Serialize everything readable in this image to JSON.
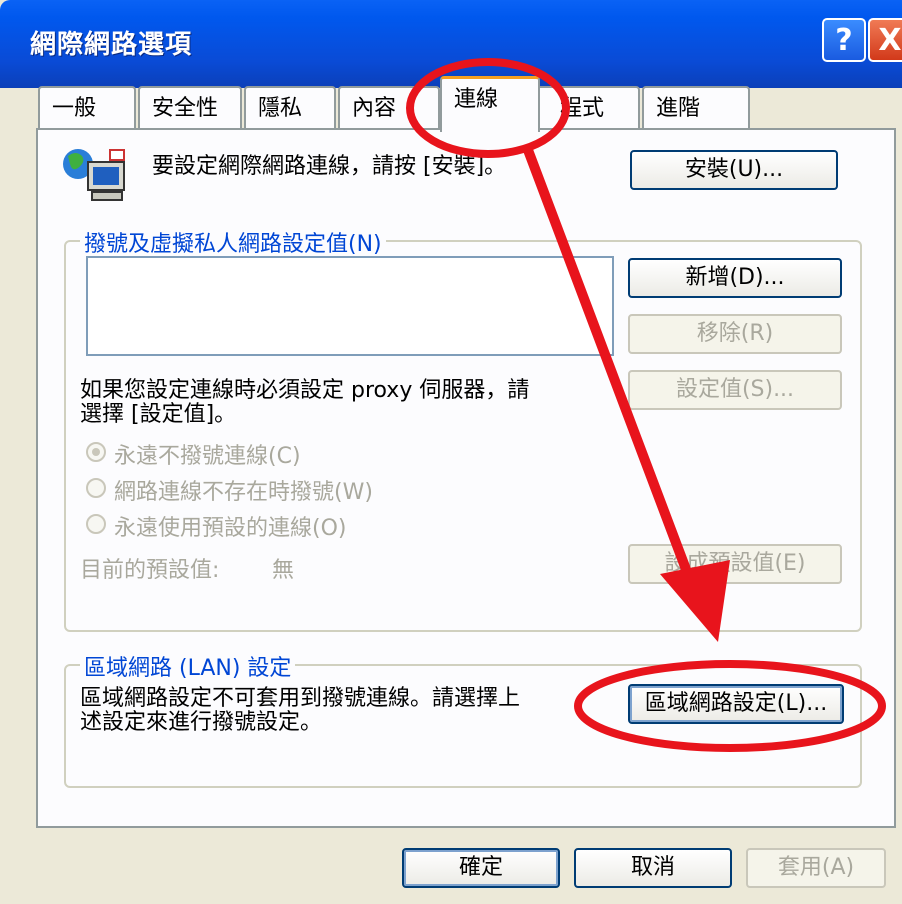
{
  "window": {
    "title": "網際網路選項",
    "help_glyph": "?",
    "close_glyph": "X"
  },
  "tabs": [
    {
      "label": "一般"
    },
    {
      "label": "安全性"
    },
    {
      "label": "隱私"
    },
    {
      "label": "內容"
    },
    {
      "label": "連線",
      "active": true
    },
    {
      "label": "程式"
    },
    {
      "label": "進階"
    }
  ],
  "setup": {
    "text": "要設定網際網路連線，請按 [安裝]。",
    "button": "安裝(U)..."
  },
  "dialup": {
    "group_label": "撥號及虛擬私人網路設定值(N)",
    "add_button": "新增(D)...",
    "remove_button": "移除(R)",
    "settings_button": "設定值(S)...",
    "proxy_text_line1": "如果您設定連線時必須設定 proxy 伺服器，請",
    "proxy_text_line2": "選擇 [設定值]。",
    "radio_never": "永遠不撥號連線(C)",
    "radio_when_absent": "網路連線不存在時撥號(W)",
    "radio_always": "永遠使用預設的連線(O)",
    "default_label": "目前的預設值:",
    "default_value": "無",
    "set_default_button": "設成預設值(E)"
  },
  "lan": {
    "group_label": "區域網路 (LAN) 設定",
    "text_line1": "區域網路設定不可套用到撥號連線。請選擇上",
    "text_line2": "述設定來進行撥號設定。",
    "button": "區域網路設定(L)..."
  },
  "footer": {
    "ok": "確定",
    "cancel": "取消",
    "apply": "套用(A)"
  },
  "colors": {
    "annotation": "#e8141c",
    "title_bar": "#0a4bd6",
    "group_label": "#0046d5"
  },
  "icons": {
    "network": "network-computer-icon"
  }
}
